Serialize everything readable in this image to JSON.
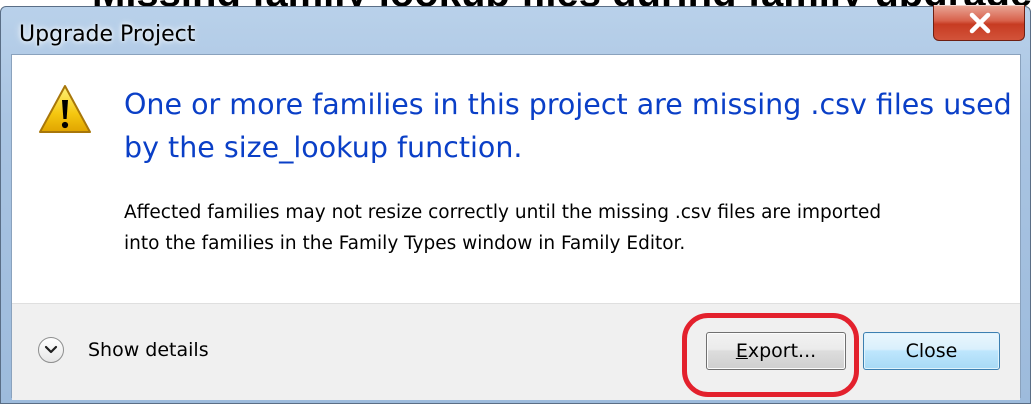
{
  "background": {
    "cropped_text": "Missing family lookup files during family upgrade"
  },
  "window": {
    "title": "Upgrade Project",
    "close_glyph": "x"
  },
  "message": {
    "icon": "warning-icon",
    "heading_line1": "One or more families in this project are missing .csv files used",
    "heading_line2": "by the size_lookup function.",
    "body_line1": "Affected families may not resize correctly until the missing .csv files are imported",
    "body_line2": "into the families in the Family Types window in Family Editor."
  },
  "footer": {
    "details_label": "Show details",
    "export_label": "Export...",
    "close_label": "Close"
  },
  "colors": {
    "heading": "#0a3fc7",
    "annotation": "#e3212d",
    "close_button_red": "#c73b22"
  }
}
